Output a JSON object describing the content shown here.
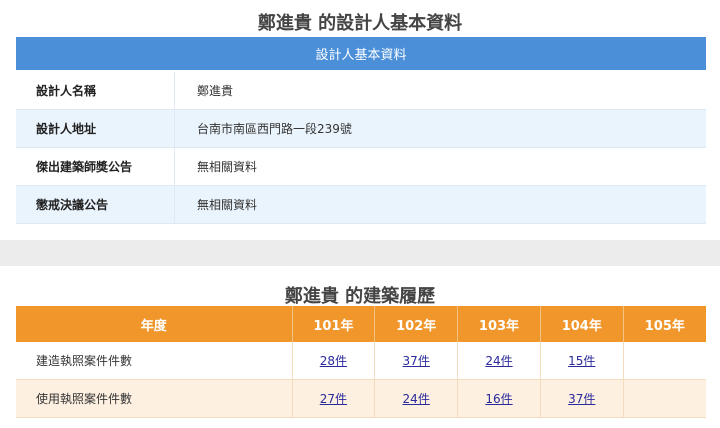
{
  "profile": {
    "title": "鄭進貴 的設計人基本資料",
    "header": "設計人基本資料",
    "rows": [
      {
        "label": "設計人名稱",
        "value": "鄭進貴"
      },
      {
        "label": "設計人地址",
        "value": "台南市南區西門路一段239號"
      },
      {
        "label": "傑出建築師獎公告",
        "value": "無相關資料"
      },
      {
        "label": "懲戒決議公告",
        "value": "無相關資料"
      }
    ]
  },
  "history": {
    "title": "鄭進貴 的建築履歷",
    "headers": [
      "年度",
      "101年",
      "102年",
      "103年",
      "104年",
      "105年"
    ],
    "rows": [
      {
        "label": "建造執照案件件數",
        "values": [
          "28件",
          "37件",
          "24件",
          "15件",
          ""
        ]
      },
      {
        "label": "使用執照案件件數",
        "values": [
          "27件",
          "24件",
          "16件",
          "37件",
          ""
        ]
      }
    ]
  },
  "colors": {
    "blue_header": "#4a8fd8",
    "orange_header": "#f0962a",
    "link": "#2a2a9a"
  }
}
